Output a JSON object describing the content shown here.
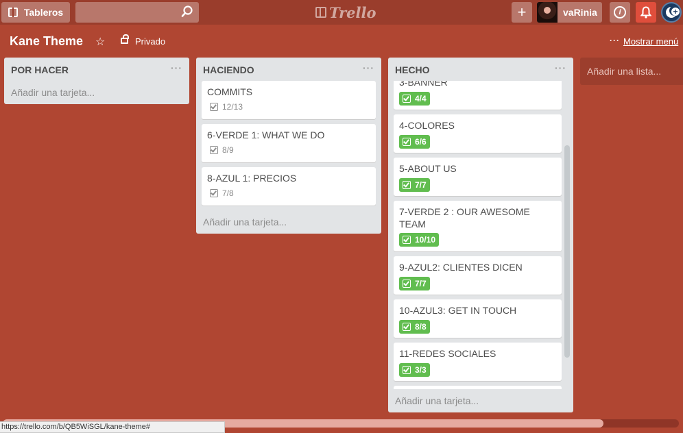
{
  "header": {
    "boards_label": "Tableros",
    "search_value": "",
    "logo_text": "Trello",
    "user_name": "vaRinia",
    "plus_label": "+",
    "info_label": "i"
  },
  "board": {
    "title": "Kane Theme",
    "visibility": "Privado",
    "show_menu": "Mostrar menú"
  },
  "lists": [
    {
      "name": "POR HACER",
      "add_card": "Añadir una tarjeta...",
      "cards": []
    },
    {
      "name": "HACIENDO",
      "add_card": "Añadir una tarjeta...",
      "cards": [
        {
          "title": "COMMITS",
          "checklist": "12/13"
        },
        {
          "title": "6-VERDE 1: WHAT WE DO",
          "checklist": "8/9"
        },
        {
          "title": "8-AZUL 1: PRECIOS",
          "checklist": "7/8"
        }
      ]
    },
    {
      "name": "HECHO",
      "add_card": "Añadir una tarjeta...",
      "cards": [
        {
          "title": "3-BANNER",
          "checklist": "4/4"
        },
        {
          "title": "4-COLORES",
          "checklist": "6/6"
        },
        {
          "title": "5-ABOUT US",
          "checklist": "7/7"
        },
        {
          "title": "7-VERDE 2 : OUR AWESOME TEAM",
          "checklist": "10/10"
        },
        {
          "title": "9-AZUL2: CLIENTES DICEN",
          "checklist": "7/7"
        },
        {
          "title": "10-AZUL3: GET IN TOUCH",
          "checklist": "8/8"
        },
        {
          "title": "11-REDES SOCIALES",
          "checklist": "3/3"
        }
      ]
    }
  ],
  "add_list": "Añadir una lista...",
  "status_url": "https://trello.com/b/QB5WiSGL/kane-theme#",
  "colors": {
    "board_bg": "#b04632",
    "header_bg": "#9a3d2c",
    "checklist_complete": "#61bd4f",
    "notification": "#e04e3c"
  }
}
